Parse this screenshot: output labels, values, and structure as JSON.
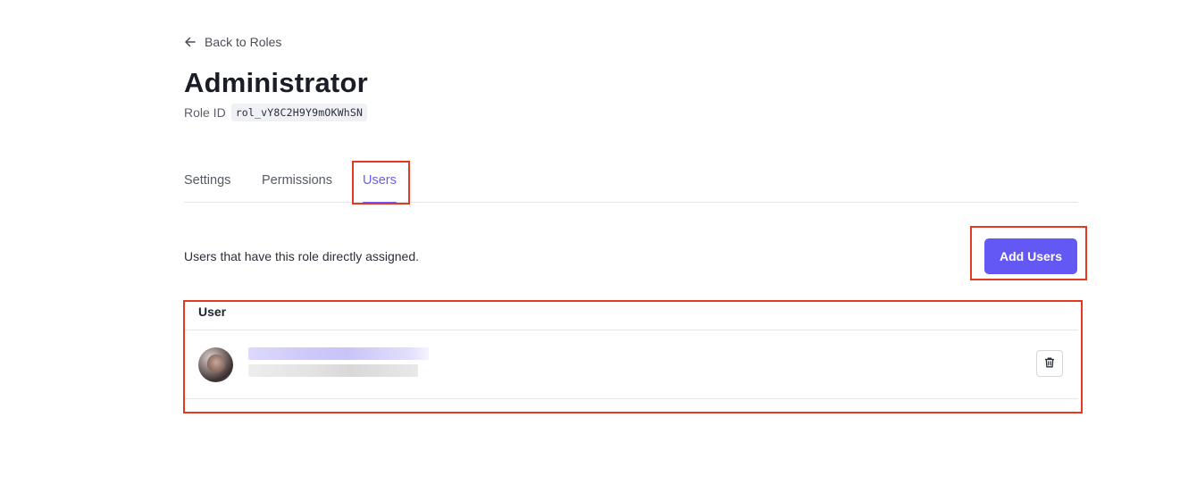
{
  "nav": {
    "back_label": "Back to Roles",
    "back_icon": "arrow-left-icon"
  },
  "role": {
    "title": "Administrator",
    "id_label": "Role ID",
    "id_value": "rol_vY8C2H9Y9mOKWhSN"
  },
  "tabs": [
    {
      "label": "Settings",
      "active": false
    },
    {
      "label": "Permissions",
      "active": false
    },
    {
      "label": "Users",
      "active": true
    }
  ],
  "users_tab": {
    "description": "Users that have this role directly assigned.",
    "add_button_label": "Add Users",
    "table": {
      "columns": [
        "User"
      ],
      "rows": [
        {
          "avatar": "user-avatar-photo",
          "delete_icon": "trash-icon"
        }
      ]
    }
  },
  "colors": {
    "accent": "#6458f5",
    "active_tab": "#6a5cf0",
    "highlight": "#e23a22"
  }
}
